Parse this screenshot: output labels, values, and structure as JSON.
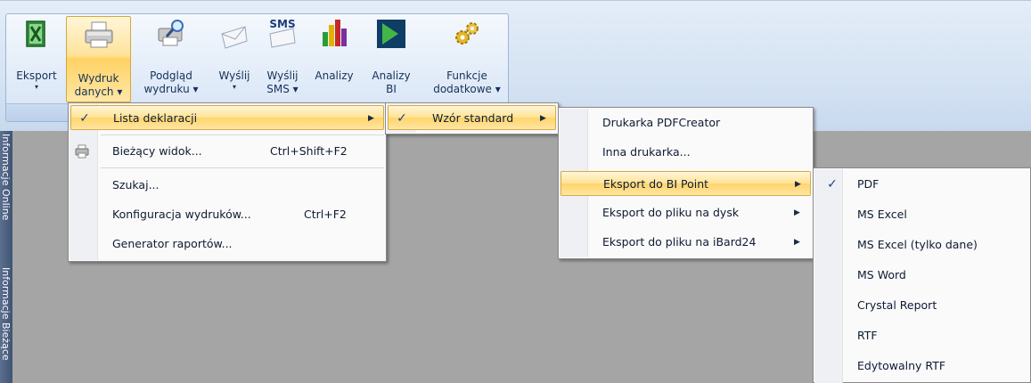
{
  "ribbon": {
    "buttons": [
      {
        "line1": "Eksport",
        "line2": "▾"
      },
      {
        "line1": "Wydruk",
        "line2": "danych ▾"
      },
      {
        "line1": "Podgląd",
        "line2": "wydruku ▾"
      },
      {
        "line1": "Wyślij",
        "line2": "▾"
      },
      {
        "line1": "Wyślij",
        "line2": "SMS ▾"
      },
      {
        "line1": "Analizy",
        "line2": ""
      },
      {
        "line1": "Analizy",
        "line2": "BI"
      },
      {
        "line1": "Funkcje",
        "line2": "dodatkowe ▾"
      }
    ],
    "sms_badge": "SMS"
  },
  "sidebar": {
    "tabs": [
      "Informacje Online",
      "Informacje Bieżące"
    ]
  },
  "menu1": {
    "items": [
      {
        "label": "Lista deklaracji",
        "checked": "✓"
      },
      {
        "label": "Bieżący widok...",
        "shortcut": "Ctrl+Shift+F2"
      },
      {
        "label": "Szukaj..."
      },
      {
        "label": "Konfiguracja wydruków...",
        "shortcut": "Ctrl+F2"
      },
      {
        "label": "Generator raportów..."
      }
    ]
  },
  "menu2": {
    "items": [
      {
        "label": "Wzór standard",
        "checked": "✓"
      }
    ]
  },
  "menu3": {
    "items": [
      {
        "label": "Drukarka PDFCreator"
      },
      {
        "label": "Inna drukarka..."
      },
      {
        "label": "Eksport do BI Point"
      },
      {
        "label": "Eksport do pliku na dysk"
      },
      {
        "label": "Eksport do pliku na iBard24"
      }
    ]
  },
  "menu4": {
    "items": [
      {
        "label": "PDF",
        "checked": "✓"
      },
      {
        "label": "MS Excel"
      },
      {
        "label": "MS Excel (tylko dane)"
      },
      {
        "label": "MS Word"
      },
      {
        "label": "Crystal Report"
      },
      {
        "label": "RTF"
      },
      {
        "label": "Edytowalny RTF"
      }
    ]
  },
  "submenu_arrow": "▶",
  "colors": {
    "highlight": "#ffe394",
    "ribbon": "#dfe9f5",
    "workspace": "#a5a5a5"
  }
}
